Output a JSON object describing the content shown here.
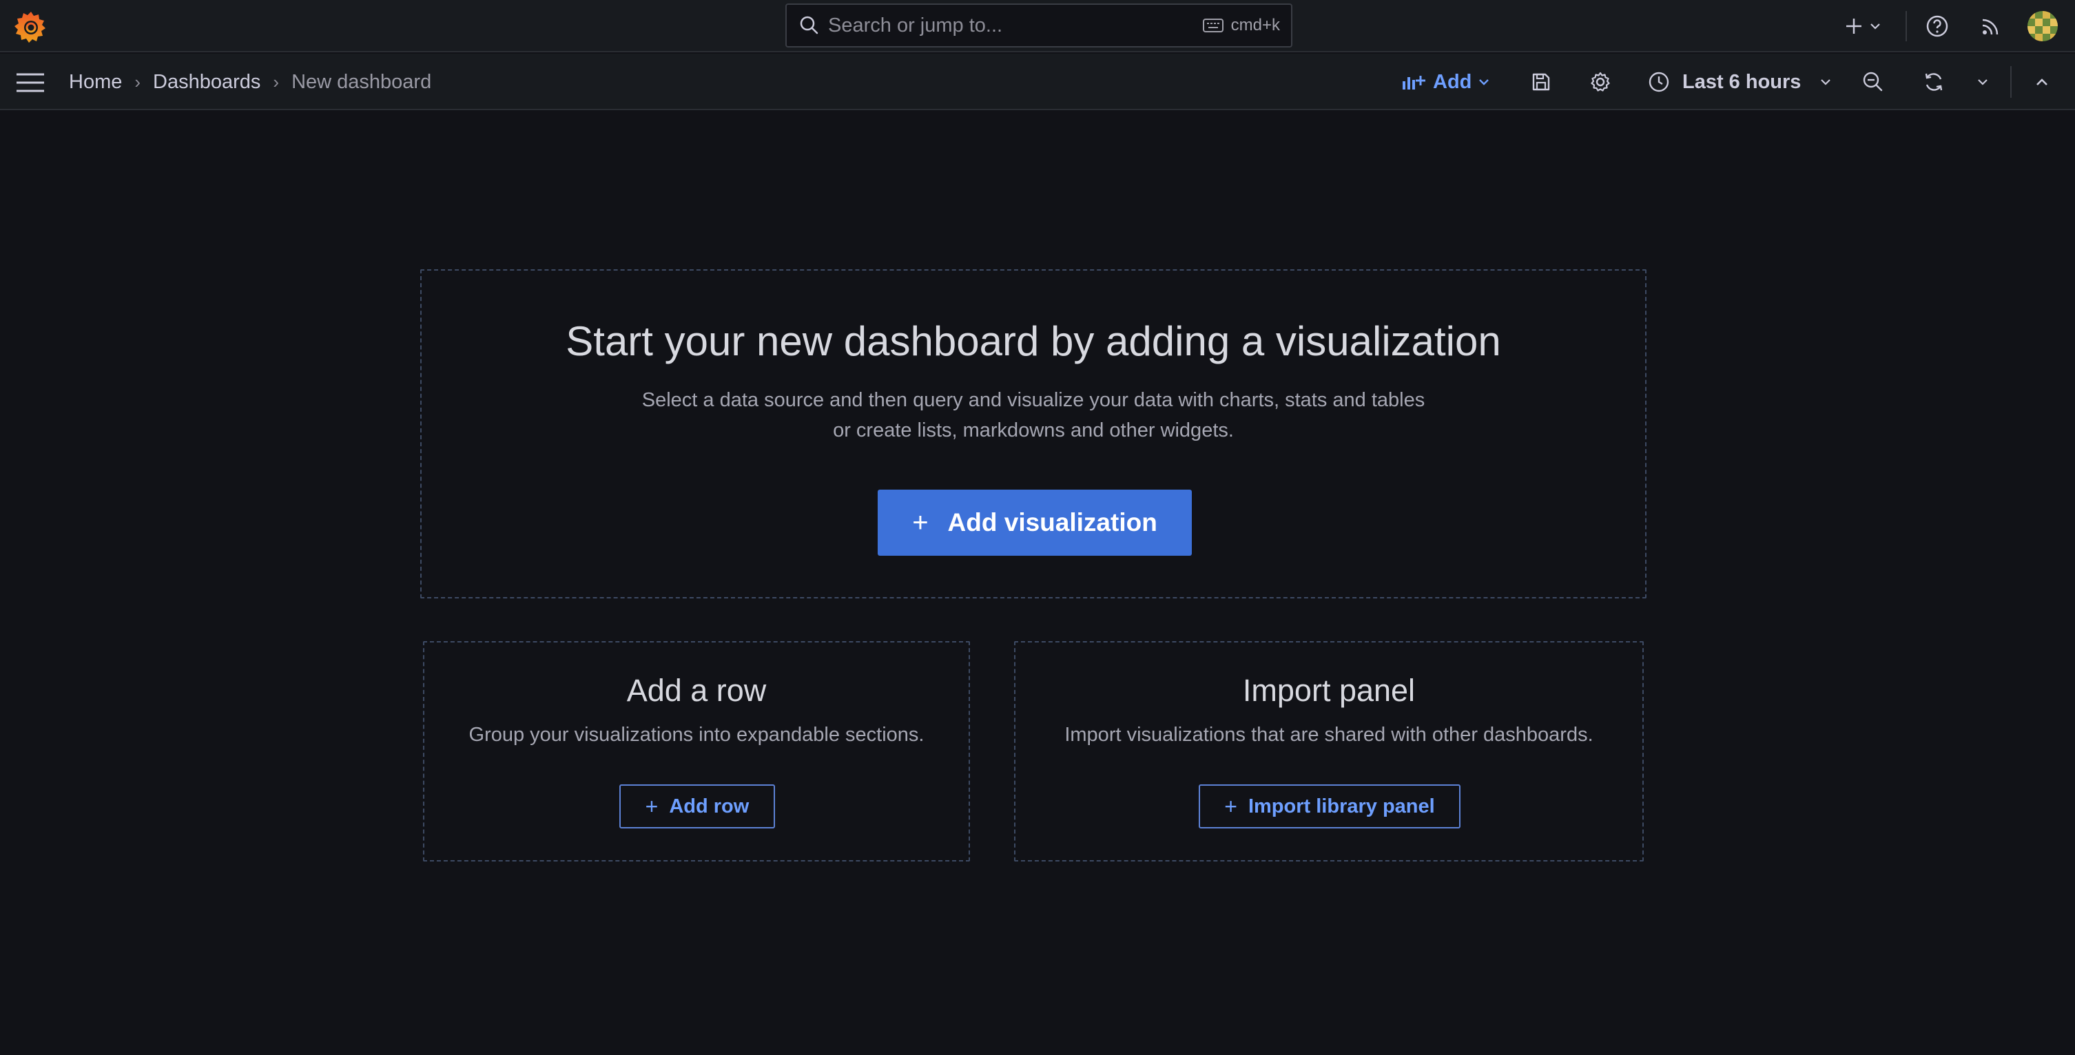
{
  "topbar": {
    "search_placeholder": "Search or jump to...",
    "search_shortcut": "cmd+k",
    "icons": [
      "grafana-logo-icon",
      "search-icon",
      "keyboard-icon",
      "plus-icon",
      "chevron-down-icon",
      "help-icon",
      "news-feed-icon",
      "user-avatar"
    ]
  },
  "navbar": {
    "breadcrumb": [
      "Home",
      "Dashboards",
      "New dashboard"
    ],
    "add_label": "Add",
    "time_range": "Last 6 hours"
  },
  "hero": {
    "title": "Start your new dashboard by adding a visualization",
    "desc_line1": "Select a data source and then query and visualize your data with charts, stats and tables",
    "desc_line2": "or create lists, markdowns and other widgets.",
    "button_label": "Add visualization"
  },
  "row_card": {
    "title": "Add a row",
    "desc": "Group your visualizations into expandable sections.",
    "button_label": "Add row"
  },
  "import_card": {
    "title": "Import panel",
    "desc": "Import visualizations that are shared with other dashboards.",
    "button_label": "Import library panel"
  },
  "colors": {
    "background": "#111217",
    "bar": "#181b1f",
    "primary": "#3d71d9",
    "link": "#6e9fff",
    "logo": "#f05a28"
  }
}
